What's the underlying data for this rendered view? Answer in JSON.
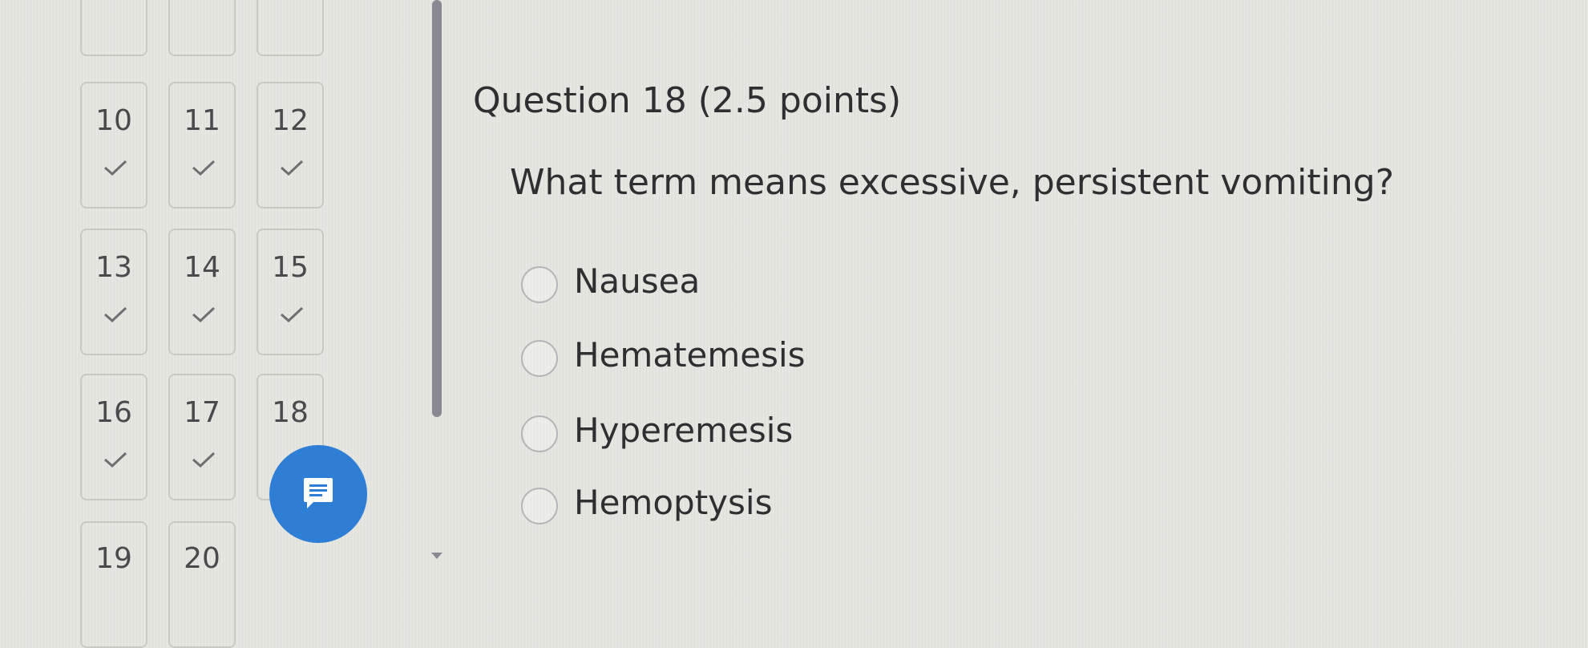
{
  "navigator": {
    "tiles": [
      {
        "number": "10",
        "answered": true
      },
      {
        "number": "11",
        "answered": true
      },
      {
        "number": "12",
        "answered": true
      },
      {
        "number": "13",
        "answered": true
      },
      {
        "number": "14",
        "answered": true
      },
      {
        "number": "15",
        "answered": true
      },
      {
        "number": "16",
        "answered": true
      },
      {
        "number": "17",
        "answered": true
      },
      {
        "number": "18",
        "answered": false
      },
      {
        "number": "19",
        "answered": false
      },
      {
        "number": "20",
        "answered": false
      }
    ],
    "feedback_icon": "message-icon"
  },
  "question": {
    "title": "Question 18 (2.5 points)",
    "text": "What term means excessive, persistent vomiting?",
    "options": [
      "Nausea",
      "Hematemesis",
      "Hyperemesis",
      "Hemoptysis"
    ]
  },
  "colors": {
    "accent": "#2f7ed6",
    "scrollbar": "#8a8893",
    "check": "#6f6f72"
  }
}
